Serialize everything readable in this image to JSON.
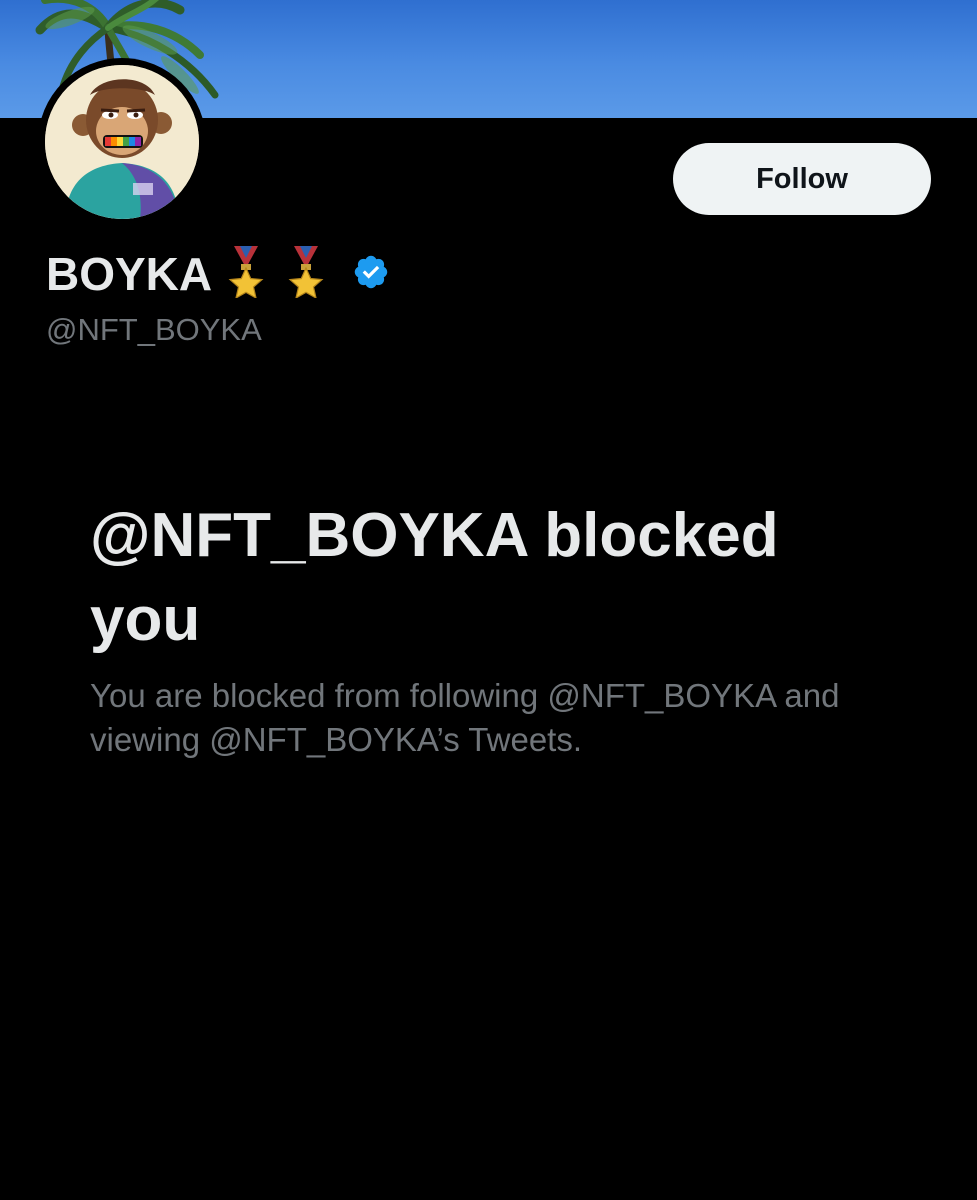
{
  "profile": {
    "display_name": "BOYKA",
    "handle": "@NFT_BOYKA",
    "badges": [
      "military-medal-icon",
      "military-medal-icon"
    ],
    "verified": true
  },
  "actions": {
    "follow_label": "Follow"
  },
  "blocked": {
    "title": "@NFT_BOYKA blocked you",
    "description": "You are blocked from following @NFT_BOYKA and viewing @NFT_BOYKA’s Tweets."
  },
  "colors": {
    "background": "#000000",
    "primary_text": "#e7e9ea",
    "secondary_text": "#71767b",
    "button_bg": "#eff3f4",
    "button_text": "#0f1419",
    "verified_blue": "#1d9bf0",
    "banner_sky": "#4a8be2"
  }
}
